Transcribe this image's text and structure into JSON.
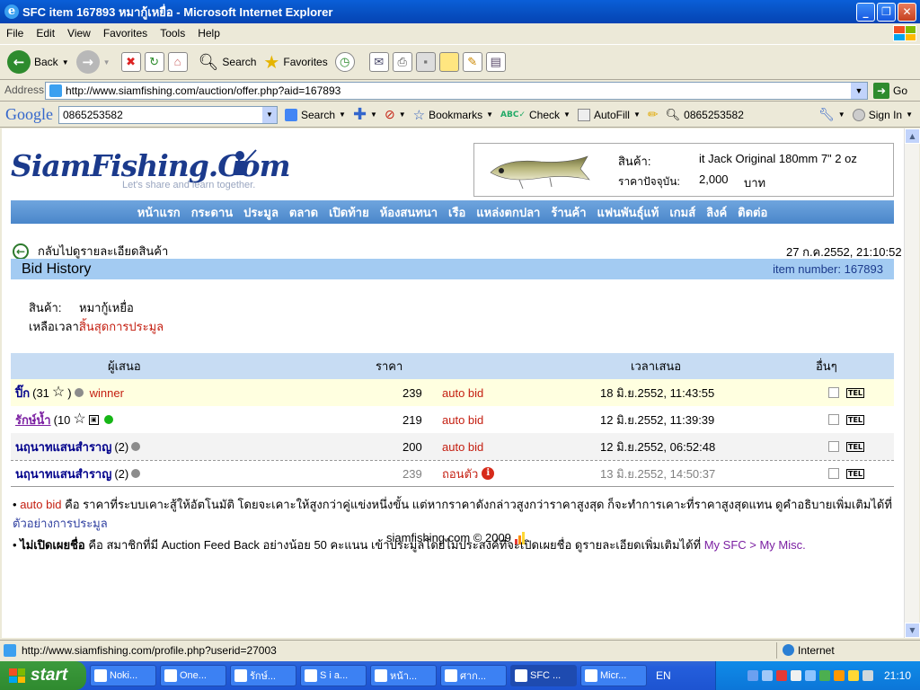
{
  "window": {
    "title": "SFC item 167893 หมากู้เหยื่อ - Microsoft Internet Explorer"
  },
  "menu": [
    "File",
    "Edit",
    "View",
    "Favorites",
    "Tools",
    "Help"
  ],
  "toolbar": {
    "back": "Back",
    "search": "Search",
    "favorites": "Favorites"
  },
  "address": {
    "label": "Address",
    "url": "http://www.siamfishing.com/auction/offer.php?aid=167893",
    "go": "Go"
  },
  "google": {
    "logo": "Google",
    "query": "0865253582",
    "search": "Search",
    "bookmarks": "Bookmarks",
    "check": "Check",
    "autofill": "AutoFill",
    "phone": "0865253582",
    "signin": "Sign In"
  },
  "site": {
    "logo": "SiamFishing.Com",
    "slogan": "Let's share and learn together.",
    "product_label": "สินค้า:",
    "product_name": "it Jack Original 180mm 7\" 2 oz",
    "price_label": "ราคาปัจจุบัน:",
    "price_value": "2,000",
    "price_unit": "บาท",
    "nav": [
      "หน้าแรก",
      "กระดาน",
      "ประมูล",
      "ตลาด",
      "เปิดท้าย",
      "ห้องสนทนา",
      "เรือ",
      "แหล่งตกปลา",
      "ร้านค้า",
      "แฟนพันธุ์แท้",
      "เกมส์",
      "ลิงค์",
      "ติดต่อ"
    ],
    "back_link": "กลับไปดูรายละเอียดสินค้า",
    "datetime": "27 ก.ค.2552, 21:10:52",
    "bid_history": "Bid History",
    "item_number_label": "item number:",
    "item_number": "167893",
    "item_label": "สินค้า:",
    "item_value": "หมากู้เหยื่อ",
    "time_left_label": "เหลือเวลา:",
    "time_left_value": "สิ้นสุดการประมูล"
  },
  "table": {
    "headers": [
      "ผู้เสนอ",
      "ราคา",
      "เวลาเสนอ",
      "อื่นๆ"
    ],
    "rows": [
      {
        "bidder": "ปิ๊ก",
        "score": "(31",
        "score_close": ")",
        "tag": "winner",
        "price": "239",
        "type": "auto bid",
        "time": "18 มิ.ย.2552, 11:43:55",
        "tel": "TEL",
        "bg": "#FFFFE0",
        "dot": "#8c8c8c"
      },
      {
        "bidder": "รักษ์น้ำ",
        "score": "(10",
        "score_close": "",
        "tag": "",
        "price": "219",
        "type": "auto bid",
        "time": "12 มิ.ย.2552, 11:39:39",
        "tel": "TEL",
        "bg": "#FFFFFF",
        "dot": "#16B616"
      },
      {
        "bidder": "นฤนาทแสนสำราญ",
        "score": "(2)",
        "score_close": "",
        "tag": "",
        "price": "200",
        "type": "auto bid",
        "time": "12 มิ.ย.2552, 06:52:48",
        "tel": "TEL",
        "bg": "#F3F3F3",
        "dot": "#8c8c8c"
      },
      {
        "bidder": "นฤนาทแสนสำราญ",
        "score": "(2)",
        "score_close": "",
        "tag": "",
        "price": "239",
        "type": "ถอนตัว",
        "time": "13 มิ.ย.2552, 14:50:37",
        "tel": "TEL",
        "bg": "#FFFFFF",
        "dot": "#8c8c8c"
      }
    ]
  },
  "notes": {
    "n1_term": "auto bid",
    "n1_text": " คือ ราคาที่ระบบเคาะสู้ให้อัตโนมัติ โดยจะเคาะให้สูงกว่าคู่แข่งหนึ่งขั้น แต่หากราคาดังกล่าวสูงกว่าราคาสูงสุด ก็จะทำการเคาะที่ราคาสูงสุดแทน ดูคำอธิบายเพิ่มเติมได้ที่ ",
    "n1_link": "ตัวอย่างการประมูล",
    "n2_term": "ไม่เปิดเผยชื่อ",
    "n2_text": " คือ สมาชิกที่มี Auction Feed Back อย่างน้อย 50 คะแนน เข้าประมูลโดยไม่ประสงค์ที่จะเปิดเผยชื่อ ดูรายละเอียดเพิ่มเติมได้ที่ ",
    "n2_link": "My SFC > My Misc.",
    "footer": "siamfishing.com © 2009"
  },
  "status": {
    "url": "http://www.siamfishing.com/profile.php?userid=27003",
    "zone": "Internet"
  },
  "taskbar": {
    "start": "start",
    "tasks": [
      "Noki...",
      "One...",
      "รักษ์...",
      "S i a...",
      "หน้า...",
      "ศาก...",
      "SFC ...",
      "Micr..."
    ],
    "lang": "EN",
    "clock": "21:10"
  }
}
